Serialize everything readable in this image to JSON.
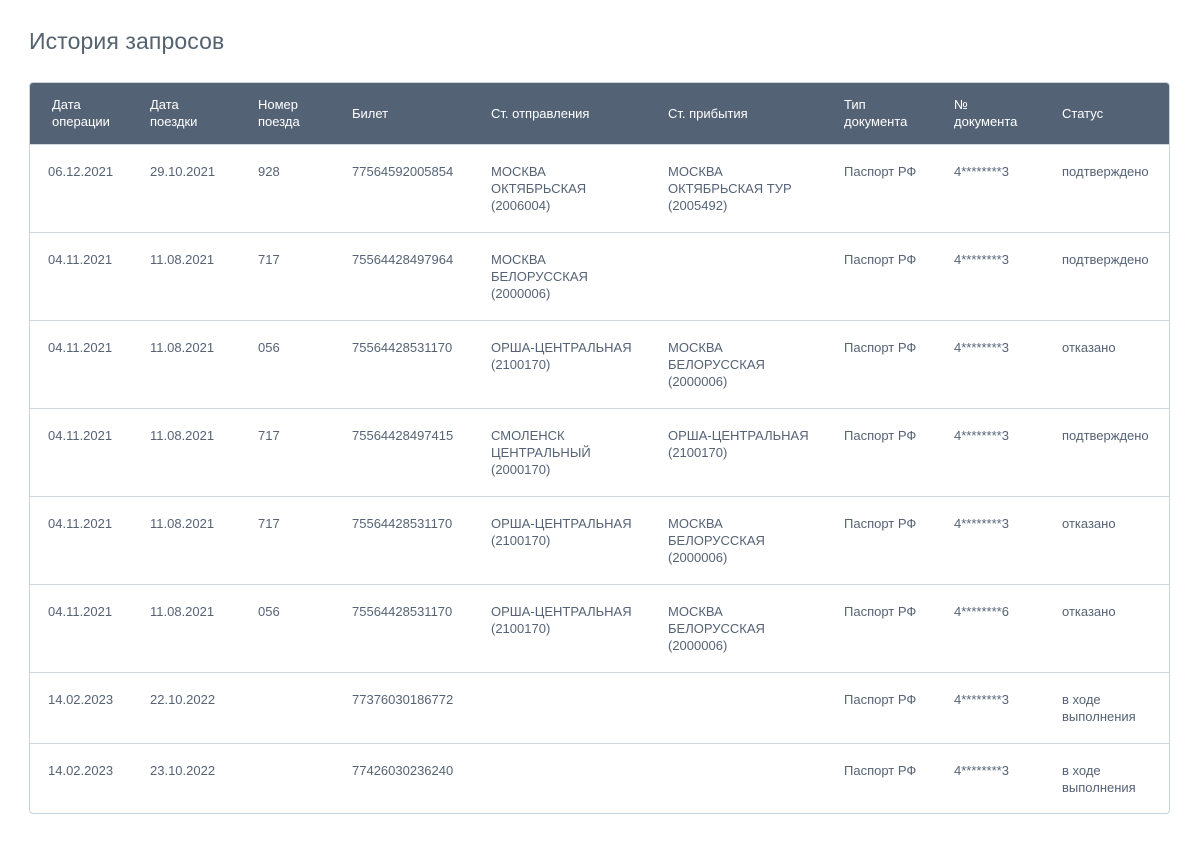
{
  "page": {
    "title": "История запросов"
  },
  "table": {
    "headers": [
      "Дата\nоперации",
      "Дата\nпоездки",
      "Номер\nпоезда",
      "Билет",
      "Ст. отправления",
      "Ст. прибытия",
      "Тип\nдокумента",
      "№\nдокумента",
      "Статус"
    ],
    "rows": [
      [
        "06.12.2021",
        "29.10.2021",
        "928",
        "77564592005854",
        "МОСКВА\nОКТЯБРЬСКАЯ\n(2006004)",
        "МОСКВА\nОКТЯБРЬСКАЯ ТУР\n(2005492)",
        "Паспорт РФ",
        "4********3",
        "подтверждено"
      ],
      [
        "04.11.2021",
        "11.08.2021",
        "717",
        "75564428497964",
        "МОСКВА\nБЕЛОРУССКАЯ\n(2000006)",
        "",
        "Паспорт РФ",
        "4********3",
        "подтверждено"
      ],
      [
        "04.11.2021",
        "11.08.2021",
        "056",
        "75564428531170",
        "ОРША-ЦЕНТРАЛЬНАЯ\n(2100170)",
        "МОСКВА\nБЕЛОРУССКАЯ\n(2000006)",
        "Паспорт РФ",
        "4********3",
        "отказано"
      ],
      [
        "04.11.2021",
        "11.08.2021",
        "717",
        "75564428497415",
        "СМОЛЕНСК\nЦЕНТРАЛЬНЫЙ\n(2000170)",
        "ОРША-ЦЕНТРАЛЬНАЯ\n(2100170)",
        "Паспорт РФ",
        "4********3",
        "подтверждено"
      ],
      [
        "04.11.2021",
        "11.08.2021",
        "717",
        "75564428531170",
        "ОРША-ЦЕНТРАЛЬНАЯ\n(2100170)",
        "МОСКВА\nБЕЛОРУССКАЯ\n(2000006)",
        "Паспорт РФ",
        "4********3",
        "отказано"
      ],
      [
        "04.11.2021",
        "11.08.2021",
        "056",
        "75564428531170",
        "ОРША-ЦЕНТРАЛЬНАЯ\n(2100170)",
        "МОСКВА\nБЕЛОРУССКАЯ\n(2000006)",
        "Паспорт РФ",
        "4********6",
        "отказано"
      ],
      [
        "14.02.2023",
        "22.10.2022",
        "",
        "77376030186772",
        "",
        "",
        "Паспорт РФ",
        "4********3",
        "в ходе\nвыполнения"
      ],
      [
        "14.02.2023",
        "23.10.2022",
        "",
        "77426030236240",
        "",
        "",
        "Паспорт РФ",
        "4********3",
        "в ходе\nвыполнения"
      ]
    ]
  },
  "colors": {
    "header_bg": "#536275",
    "title": "#55626f",
    "text": "#566375",
    "border": "#cfd8e1"
  }
}
